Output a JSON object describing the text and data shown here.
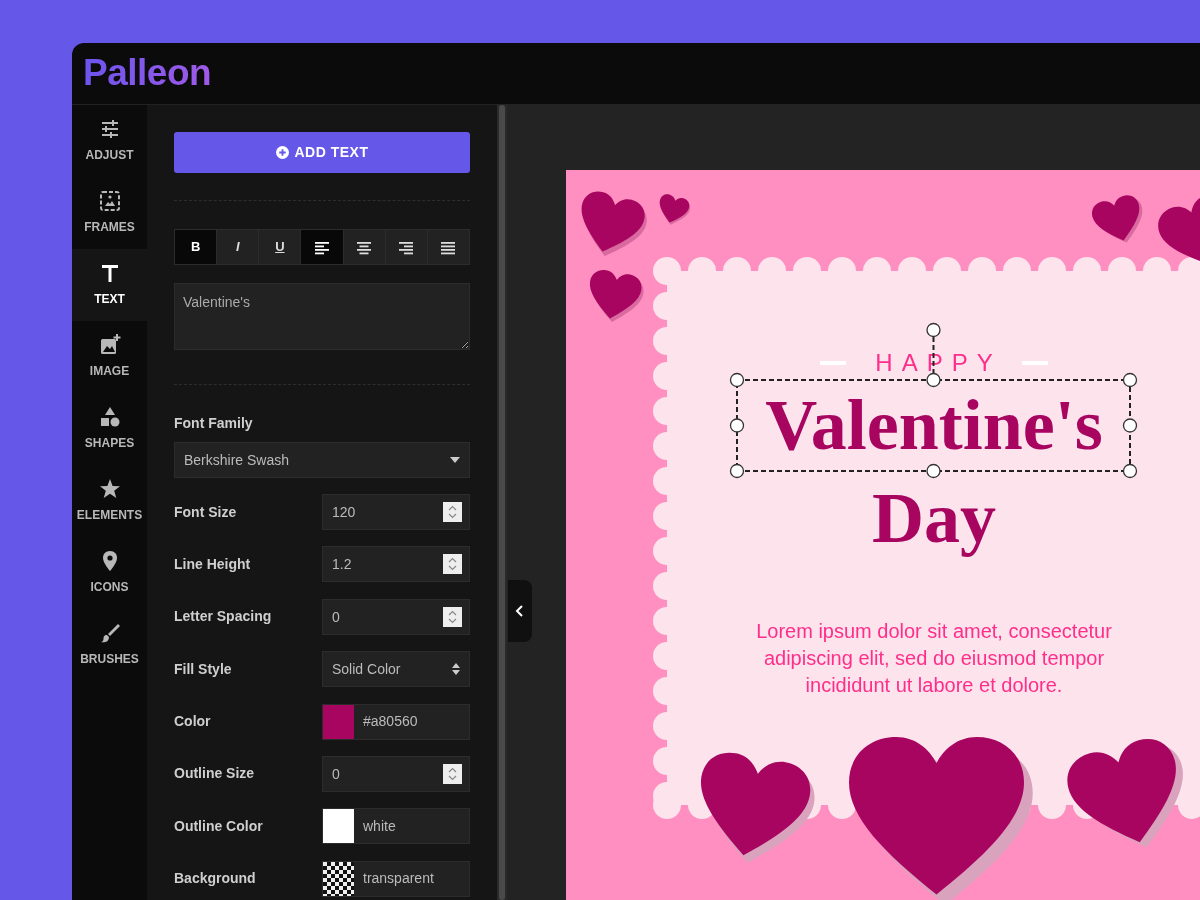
{
  "header": {
    "logo": "Palleon"
  },
  "sidebar": {
    "items": [
      {
        "kind": "adjust",
        "label": "ADJUST",
        "selected": false
      },
      {
        "kind": "frames",
        "label": "FRAMES",
        "selected": false
      },
      {
        "kind": "text",
        "label": "TEXT",
        "selected": true
      },
      {
        "kind": "image",
        "label": "IMAGE",
        "selected": false
      },
      {
        "kind": "shapes",
        "label": "SHAPES",
        "selected": false
      },
      {
        "kind": "elements",
        "label": "ELEMENTS",
        "selected": false
      },
      {
        "kind": "icons",
        "label": "ICONS",
        "selected": false
      },
      {
        "kind": "brushes",
        "label": "BRUSHES",
        "selected": false
      }
    ]
  },
  "panel": {
    "add_button": "ADD TEXT",
    "format_buttons": [
      {
        "kind": "bold",
        "label": "B",
        "selected": true
      },
      {
        "kind": "italic",
        "label": "I",
        "selected": false
      },
      {
        "kind": "underline",
        "label": "U",
        "selected": false
      },
      {
        "kind": "align-left",
        "selected": true
      },
      {
        "kind": "align-center",
        "selected": false
      },
      {
        "kind": "align-right",
        "selected": false
      },
      {
        "kind": "justify",
        "selected": false
      }
    ],
    "text_value": "Valentine's",
    "fields": [
      {
        "kind": "select",
        "label": "Font Family",
        "value": "Berkshire Swash"
      },
      {
        "kind": "number",
        "label": "Font Size",
        "value": "120"
      },
      {
        "kind": "number",
        "label": "Line Height",
        "value": "1.2"
      },
      {
        "kind": "number",
        "label": "Letter Spacing",
        "value": "0"
      },
      {
        "kind": "dropdown",
        "label": "Fill Style",
        "value": "Solid Color"
      },
      {
        "kind": "color",
        "label": "Color",
        "value": "#a80560",
        "color": "#a80560"
      },
      {
        "kind": "number",
        "label": "Outline Size",
        "value": "0"
      },
      {
        "kind": "color",
        "label": "Outline Color",
        "value": "white",
        "color": "#ffffff"
      },
      {
        "kind": "pattern",
        "label": "Background",
        "value": "transparent"
      }
    ]
  },
  "canvas": {
    "texts": [
      {
        "kind": "eyebrow",
        "text": "HAPPY"
      },
      {
        "kind": "title",
        "text": "Valentine's",
        "selected": true
      },
      {
        "kind": "title",
        "text": "Day",
        "selected": false
      },
      {
        "kind": "body",
        "text": "Lorem ipsum dolor sit amet, consectetur adipiscing elit, sed do eiusmod tempor incididunt ut labore et dolore."
      }
    ]
  }
}
